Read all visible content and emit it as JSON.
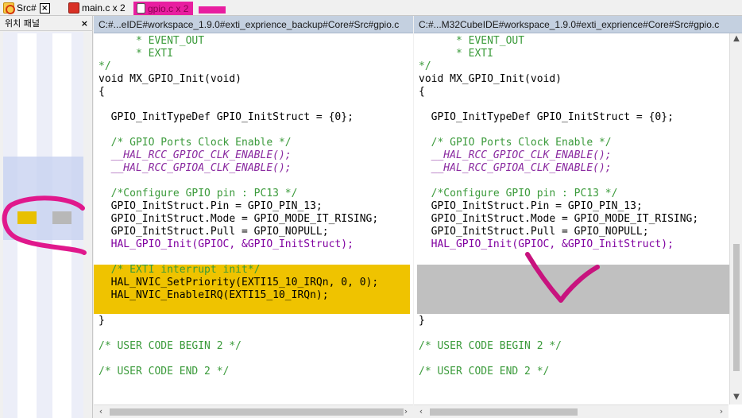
{
  "tabs": [
    {
      "label": "Src#",
      "close": "×"
    },
    {
      "label": "main.c x 2",
      "close": ""
    },
    {
      "label": "gpio.c x 2",
      "close": ""
    }
  ],
  "panel": {
    "title": "위치 패널",
    "close": "×"
  },
  "left_editor": {
    "path": "C:#...eIDE#workspace_1.9.0#exti_exprience_backup#Core#Src#gpio.c",
    "lines": [
      "      * EVENT_OUT",
      "      * EXTI",
      "*/",
      "void MX_GPIO_Init(void)",
      "{",
      "",
      "  GPIO_InitTypeDef GPIO_InitStruct = {0};",
      "",
      "  /* GPIO Ports Clock Enable */",
      "  __HAL_RCC_GPIOC_CLK_ENABLE();",
      "  __HAL_RCC_GPIOA_CLK_ENABLE();",
      "",
      "  /*Configure GPIO pin : PC13 */",
      "  GPIO_InitStruct.Pin = GPIO_PIN_13;",
      "  GPIO_InitStruct.Mode = GPIO_MODE_IT_RISING;",
      "  GPIO_InitStruct.Pull = GPIO_NOPULL;",
      "  HAL_GPIO_Init(GPIOC, &GPIO_InitStruct);",
      "",
      "  /* EXTI interrupt init*/",
      "  HAL_NVIC_SetPriority(EXTI15_10_IRQn, 0, 0);",
      "  HAL_NVIC_EnableIRQ(EXTI15_10_IRQn);",
      "",
      "}",
      "",
      "/* USER CODE BEGIN 2 */",
      "",
      "/* USER CODE END 2 */"
    ]
  },
  "right_editor": {
    "path": "C:#...M32CubeIDE#workspace_1.9.0#exti_exprience#Core#Src#gpio.c",
    "lines": [
      "      * EVENT_OUT",
      "      * EXTI",
      "*/",
      "void MX_GPIO_Init(void)",
      "{",
      "",
      "  GPIO_InitTypeDef GPIO_InitStruct = {0};",
      "",
      "  /* GPIO Ports Clock Enable */",
      "  __HAL_RCC_GPIOC_CLK_ENABLE();",
      "  __HAL_RCC_GPIOA_CLK_ENABLE();",
      "",
      "  /*Configure GPIO pin : PC13 */",
      "  GPIO_InitStruct.Pin = GPIO_PIN_13;",
      "  GPIO_InitStruct.Mode = GPIO_MODE_IT_RISING;",
      "  GPIO_InitStruct.Pull = GPIO_NOPULL;",
      "  HAL_GPIO_Init(GPIOC, &GPIO_InitStruct);",
      "",
      "",
      "",
      "",
      "",
      "}",
      "",
      "/* USER CODE BEGIN 2 */",
      "",
      "/* USER CODE END 2 */"
    ]
  },
  "colors": {
    "diff_added": "#efc300",
    "diff_missing": "#c0c0c0",
    "annotation": "#e0188c",
    "path_bar": "#c4d0e0"
  },
  "scroll": {
    "left": "‹",
    "right": "›",
    "up": "▲",
    "down": "▼"
  }
}
